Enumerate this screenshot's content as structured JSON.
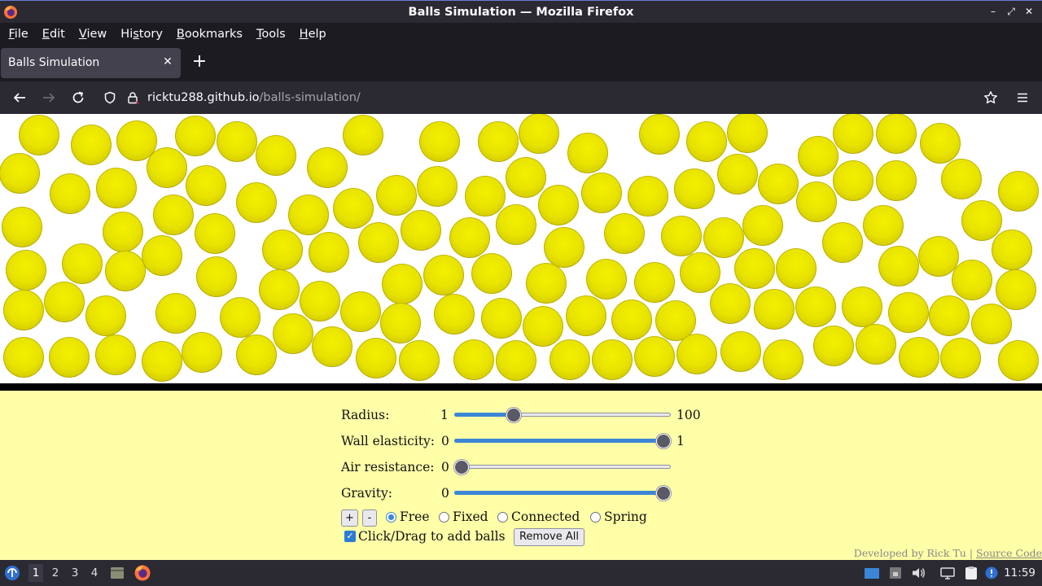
{
  "window": {
    "title": "Balls Simulation — Mozilla Firefox",
    "controls": [
      "–",
      "⤢",
      "✕"
    ]
  },
  "menubar": [
    {
      "label": "File",
      "key": "F",
      "rest": "ile"
    },
    {
      "label": "Edit",
      "key": "E",
      "rest": "dit"
    },
    {
      "label": "View",
      "key": "V",
      "rest": "iew"
    },
    {
      "label": "History",
      "key": "",
      "pre": "Hi",
      "mid": "s",
      "post": "tory"
    },
    {
      "label": "Bookmarks",
      "key": "B",
      "rest": "ookmarks"
    },
    {
      "label": "Tools",
      "key": "T",
      "rest": "ools"
    },
    {
      "label": "Help",
      "key": "H",
      "rest": "elp"
    }
  ],
  "tab": {
    "title": "Balls Simulation",
    "close": "✕"
  },
  "newtab": "+",
  "url": {
    "host": "ricktu288.github.io",
    "path": "/balls-simulation/"
  },
  "controls": {
    "radius": {
      "label": "Radius:",
      "min": "1",
      "max": "100",
      "value": 0.26
    },
    "wall": {
      "label": "Wall elasticity:",
      "min": "0",
      "max": "1",
      "value": 1.0
    },
    "air": {
      "label": "Air resistance:",
      "min": "0",
      "max": "",
      "value": 0.0
    },
    "gravity": {
      "label": "Gravity:",
      "min": "0",
      "max": "",
      "value": 1.0
    },
    "plus": "+",
    "minus": "-",
    "modes": [
      {
        "label": "Free",
        "selected": true
      },
      {
        "label": "Fixed",
        "selected": false
      },
      {
        "label": "Connected",
        "selected": false
      },
      {
        "label": "Spring",
        "selected": false
      }
    ],
    "drag_label": "Click/Drag to add balls",
    "drag_checked": true,
    "remove_all": "Remove All"
  },
  "footer": {
    "text": "Developed by Rick Tu | ",
    "link": "Source Code"
  },
  "taskbar": {
    "workspaces": [
      "1",
      "2",
      "3",
      "4"
    ],
    "active_workspace": "1",
    "clock": "11:59"
  },
  "colors": {
    "ball": "#e8e300",
    "page_bg": "#ffffa8",
    "accent": "#3b86d6"
  }
}
